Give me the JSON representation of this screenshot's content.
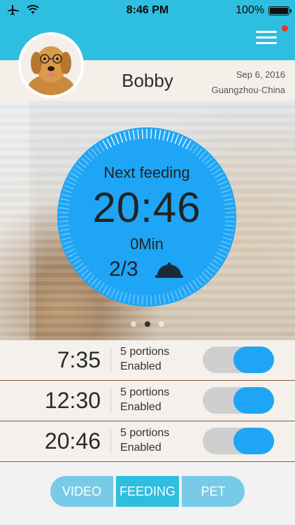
{
  "status_bar": {
    "time": "8:46 PM",
    "battery": "100%"
  },
  "profile": {
    "name": "Bobby",
    "date": "Sep 6, 2016",
    "location": "Guangzhou·China"
  },
  "feeding": {
    "label": "Next feeding",
    "time": "20:46",
    "countdown": "0Min",
    "portions": "2/3"
  },
  "pager": {
    "count": 3,
    "active_index": 1
  },
  "schedule": [
    {
      "time": "7:35",
      "portions": "5 portions",
      "status": "Enabled",
      "enabled": true
    },
    {
      "time": "12:30",
      "portions": "5 portions",
      "status": "Enabled",
      "enabled": true
    },
    {
      "time": "20:46",
      "portions": "5 portions",
      "status": "Enabled",
      "enabled": true
    }
  ],
  "tabs": [
    "VIDEO",
    "FEEDING",
    "PET"
  ],
  "colors": {
    "header": "#2ebedf",
    "dial": "#1ea5f6",
    "toggle_on": "#1ea5f6",
    "tab": "#78cbe6",
    "tab_active": "#2ebedf",
    "notification": "#e8352c"
  }
}
